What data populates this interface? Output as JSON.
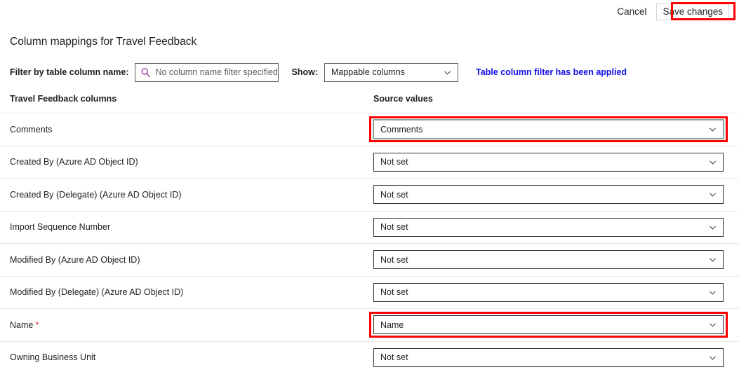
{
  "commandbar": {
    "cancel_label": "Cancel",
    "save_label": "Save changes"
  },
  "page_title": "Column mappings for Travel Feedback",
  "filter": {
    "label": "Filter by table column name:",
    "search_value": "No column name filter specified",
    "search_icon": "search-icon",
    "show_label": "Show:",
    "show_value": "Mappable columns",
    "show_icon": "chevron-down-icon",
    "applied_notice": "Table column filter has been applied"
  },
  "headers": {
    "left": "Travel Feedback columns",
    "right": "Source values"
  },
  "rows": [
    {
      "label": "Comments",
      "required": false,
      "value": "Comments",
      "highlighted": true,
      "focused": true
    },
    {
      "label": "Created By (Azure AD Object ID)",
      "required": false,
      "value": "Not set",
      "highlighted": false,
      "focused": false
    },
    {
      "label": "Created By (Delegate) (Azure AD Object ID)",
      "required": false,
      "value": "Not set",
      "highlighted": false,
      "focused": false
    },
    {
      "label": "Import Sequence Number",
      "required": false,
      "value": "Not set",
      "highlighted": false,
      "focused": false
    },
    {
      "label": "Modified By (Azure AD Object ID)",
      "required": false,
      "value": "Not set",
      "highlighted": false,
      "focused": false
    },
    {
      "label": "Modified By (Delegate) (Azure AD Object ID)",
      "required": false,
      "value": "Not set",
      "highlighted": false,
      "focused": false
    },
    {
      "label": "Name",
      "required": true,
      "required_marker": "*",
      "value": "Name",
      "highlighted": true,
      "focused": false
    },
    {
      "label": "Owning Business Unit",
      "required": false,
      "value": "Not set",
      "highlighted": false,
      "focused": false
    }
  ],
  "colors": {
    "annotation": "#ff0000",
    "link": "#0f0fe8",
    "required": "#d92121",
    "search_icon": "#8c2a8c",
    "text": "#201f1e",
    "border": "#323130",
    "separator": "#e8e8e8",
    "focus_border": "#8aa6a4"
  }
}
